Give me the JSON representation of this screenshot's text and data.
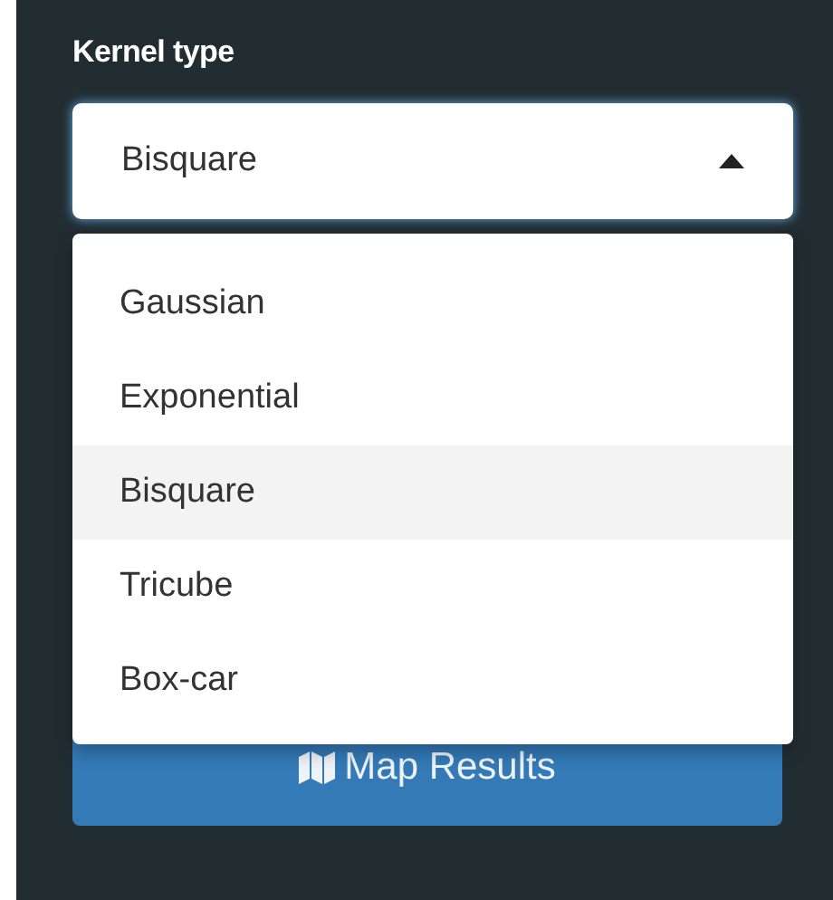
{
  "label": "Kernel type",
  "select": {
    "value": "Bisquare",
    "expanded": true
  },
  "options": [
    {
      "label": "Gaussian",
      "selected": false
    },
    {
      "label": "Exponential",
      "selected": false
    },
    {
      "label": "Bisquare",
      "selected": true
    },
    {
      "label": "Tricube",
      "selected": false
    },
    {
      "label": "Box-car",
      "selected": false
    }
  ],
  "button": {
    "label": "Map Results"
  }
}
